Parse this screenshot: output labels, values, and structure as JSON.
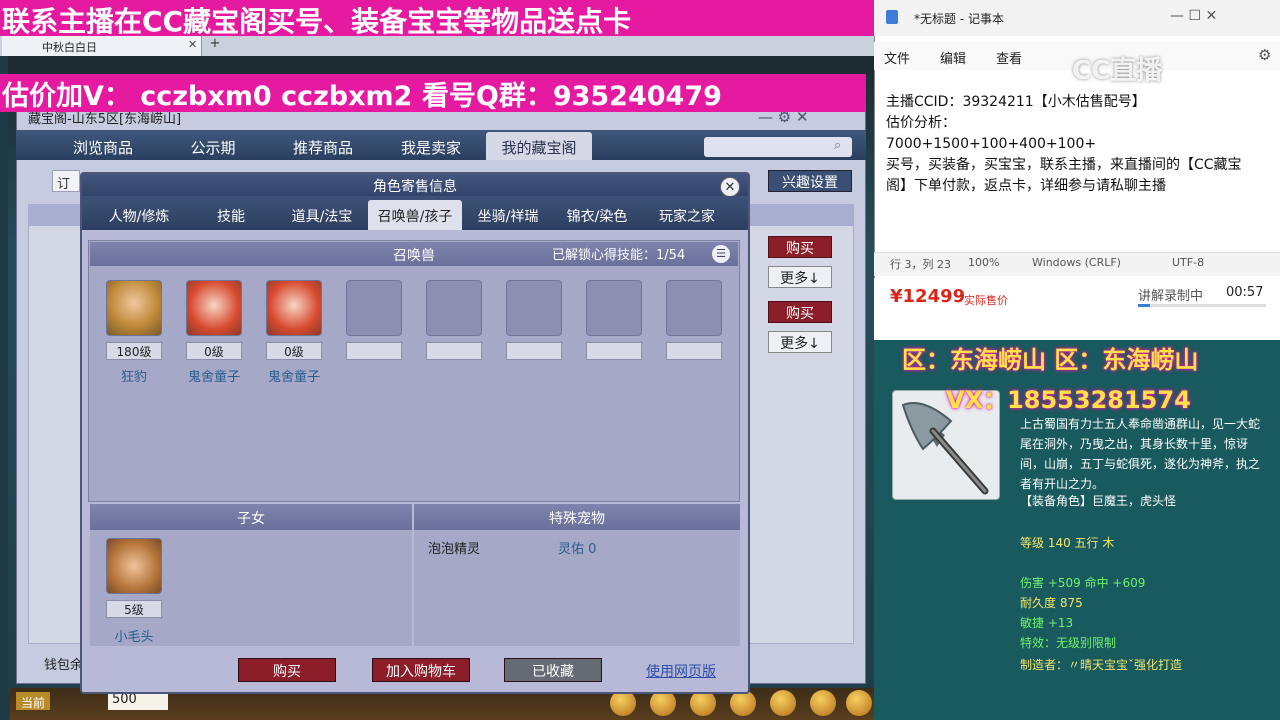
{
  "banner": {
    "top": "联系主播在CC藏宝阁买号、装备宝宝等物品送点卡",
    "valuation": "估价加V：  cczbxm0   cczbxm2   看号Q群：935240479"
  },
  "game_tab": {
    "label": "中秋白白日",
    "close": "✕",
    "add": "+"
  },
  "shop": {
    "title": "藏宝阁-山东5区[东海崂山]",
    "nav": [
      "浏览商品",
      "公示期",
      "推荐商品",
      "我是卖家",
      "我的藏宝阁"
    ],
    "filter_label": "订",
    "interest_button": "兴趣设置",
    "buy_label": "购买",
    "more_label": "更多↓",
    "wallet_label": "钱包余",
    "ctrls": "— ⚙ ✕"
  },
  "bottom_bar": {
    "current": "当前",
    "money": "500"
  },
  "dialog": {
    "title": "角色寄售信息",
    "close": "✕",
    "tabs": [
      "人物/修炼",
      "技能",
      "道具/法宝",
      "召唤兽/孩子",
      "坐骑/祥瑞",
      "锦衣/染色",
      "玩家之家"
    ],
    "pets": {
      "header": "召唤兽",
      "unlock_label": "已解锁心得技能：",
      "unlock_value": "1/54",
      "list": [
        {
          "level": "180级",
          "name": "狂豹"
        },
        {
          "level": "0级",
          "name": "鬼舍童子"
        },
        {
          "level": "0级",
          "name": "鬼舍童子"
        }
      ]
    },
    "children": {
      "header": "子女",
      "level": "5级",
      "name": "小毛头"
    },
    "special": {
      "header": "特殊宠物",
      "name": "泡泡精灵",
      "value": "灵佑 0"
    },
    "buttons": {
      "buy": "购买",
      "cart": "加入购物车",
      "fav": "已收藏",
      "web": "使用网页版"
    }
  },
  "notepad": {
    "title": "*无标题 - 记事本",
    "ctrls": "—  ☐  ✕",
    "menu": [
      "文件",
      "编辑",
      "查看"
    ],
    "lines": [
      "主播CCID：39324211【小木估售配号】",
      "估价分析：",
      "7000+1500+100+400+100+",
      "买号，买装备，买宝宝，联系主播，来直播间的【CC藏宝",
      "阁】下单付款，返点卡，详细参与请私聊主播"
    ],
    "status": [
      "行 3，列 23",
      "100%",
      "Windows (CRLF)",
      "UTF-8"
    ]
  },
  "cc_logo": "CC直播",
  "price": {
    "value": "¥12499",
    "label": "实际售价",
    "rec_label": "讲解录制中",
    "rec_time": "00:57",
    "rec_progress": 0.09
  },
  "overlay": {
    "area": "区：东海崂山  区：东海崂山",
    "vx": "VX：18553281574"
  },
  "item": {
    "description": "上古蜀国有力士五人奉命凿通群山，见一大蛇尾在洞外，乃曳之出，其身长数十里，惊讶间，山崩，五丁与蛇俱死，遂化为神斧，执之者有开山之力。",
    "role": "【装备角色】巨魔王，虎头怪",
    "level": "等级 140 五行 木",
    "attack": "伤害 +509 命中 +609",
    "durability": "耐久度 875",
    "agility": "敏捷 +13",
    "effect": "特效：无级别限制",
    "maker": "制造者：〃晴天宝宝ˇ强化打造"
  },
  "colors": {
    "banner": "#e61aa0",
    "buy": "#8c1e2a",
    "price": "#d9261c",
    "overlay_text": "#ffe14a"
  }
}
